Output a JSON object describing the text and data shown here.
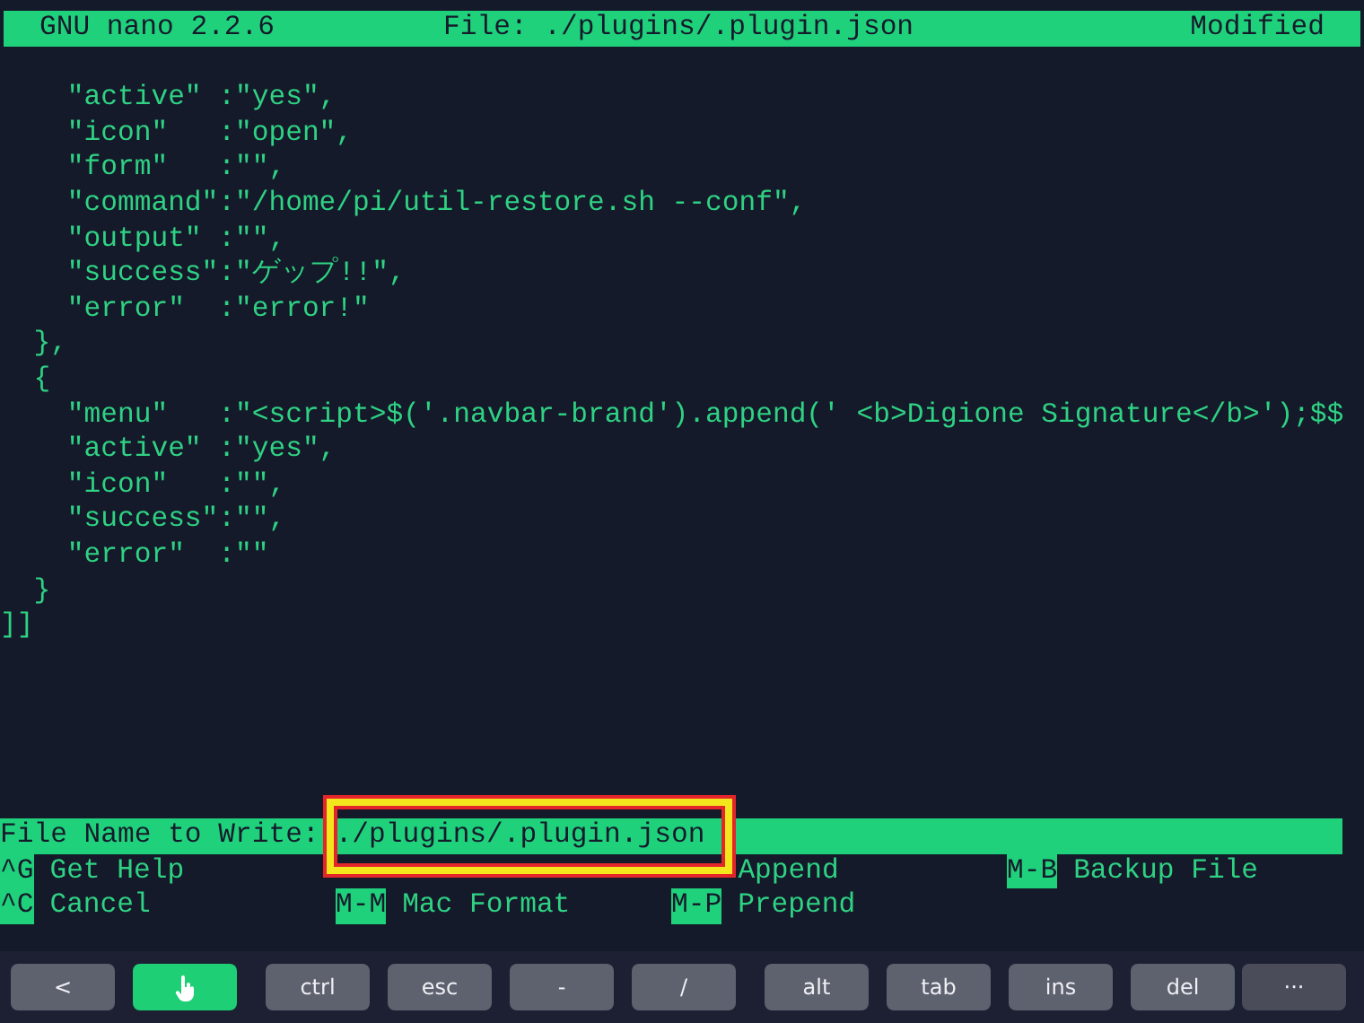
{
  "title_bar": {
    "app": "GNU nano 2.2.6",
    "file": "File: ./plugins/.plugin.json",
    "status": "Modified"
  },
  "lines": [
    "    \"active\" :\"yes\",",
    "    \"icon\"   :\"open\",",
    "    \"form\"   :\"\",",
    "    \"command\":\"/home/pi/util-restore.sh --conf\",",
    "    \"output\" :\"\",",
    "    \"success\":\"ゲップ!!\",",
    "    \"error\"  :\"error!\"",
    "  },",
    "  {",
    "    \"menu\"   :\"<script>$('.navbar-brand').append(' <b>Digione Signature</b>');$$",
    "    \"active\" :\"yes\",",
    "    \"icon\"   :\"\",",
    "    \"success\":\"\",",
    "    \"error\"  :\"\"",
    "  }",
    "]]"
  ],
  "prompt": {
    "label": "File Name to Write:",
    "value": "./plugins/.plugin.json",
    "highlighted": true
  },
  "shortcuts": [
    [
      {
        "key": "^G",
        "label": "Get Help"
      },
      {
        "label": "Append"
      },
      {
        "key": "M-B",
        "label": "Backup File"
      }
    ],
    [
      {
        "key": "^C",
        "label": "Cancel"
      },
      {
        "key": "M-M",
        "label": "Mac Format"
      },
      {
        "key": "M-P",
        "label": "Prepend"
      }
    ]
  ],
  "keyboard_bar": [
    {
      "kind": "key",
      "label": "<",
      "on": false
    },
    {
      "kind": "touch",
      "on": true
    },
    {
      "kind": "key",
      "label": "ctrl",
      "on": false
    },
    {
      "kind": "key",
      "label": "esc",
      "on": false
    },
    {
      "kind": "key",
      "label": "-",
      "on": false
    },
    {
      "kind": "key",
      "label": "/",
      "on": false
    },
    {
      "kind": "key",
      "label": "alt",
      "on": false
    },
    {
      "kind": "key",
      "label": "tab",
      "on": false
    },
    {
      "kind": "key",
      "label": "ins",
      "on": false
    },
    {
      "kind": "key",
      "label": "del",
      "on": false
    },
    {
      "kind": "key",
      "label": "···",
      "on": false
    }
  ]
}
